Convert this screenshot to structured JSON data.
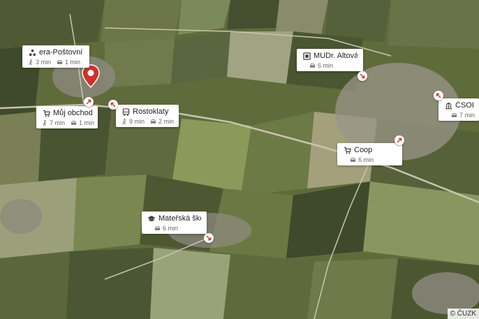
{
  "map": {
    "copyright": "© ČUZK",
    "accent_color": "#d0312d",
    "pois": [
      {
        "id": "post",
        "icon": "post-office-icon",
        "title": "era-Poštovní spoř...",
        "walk": "3 min",
        "drive": "1 min"
      },
      {
        "id": "shop",
        "icon": "cart-icon",
        "title": "Můj obchod",
        "walk": "7 min",
        "drive": "1 min"
      },
      {
        "id": "bus",
        "icon": "bus-icon",
        "title": "Rostoklaty",
        "walk": "9 min",
        "drive": "2 min"
      },
      {
        "id": "doctor",
        "icon": "medical-icon",
        "title": "MUDr. Altová Mar...",
        "walk": "",
        "drive": "6 min"
      },
      {
        "id": "bank",
        "icon": "bank-icon",
        "title": "ČSOB",
        "walk": "",
        "drive": "7 min"
      },
      {
        "id": "coop",
        "icon": "cart-icon",
        "title": "Coop",
        "walk": "",
        "drive": "6 min"
      },
      {
        "id": "school",
        "icon": "school-icon",
        "title": "Mateřská škola Ti...",
        "walk": "",
        "drive": "6 min"
      }
    ]
  }
}
